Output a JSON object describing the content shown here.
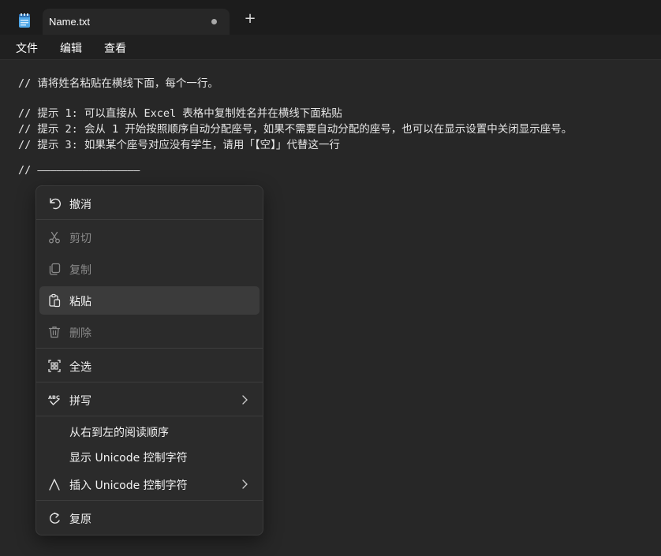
{
  "window": {
    "tab_title": "Name.txt",
    "new_tab_label": "+"
  },
  "menu": {
    "file": "文件",
    "edit": "编辑",
    "view": "查看"
  },
  "editor": {
    "lines": [
      "// 请将姓名粘贴在横线下面，每个一行。",
      "",
      "// 提示 1: 可以直接从 Excel 表格中复制姓名并在横线下面粘贴",
      "// 提示 2: 会从 1 开始按照顺序自动分配座号，如果不需要自动分配的座号，也可以在显示设置中关闭显示座号。",
      "// 提示 3: 如果某个座号对应没有学生，请用「【空】」代替这一行",
      "",
      "// ————————————————"
    ]
  },
  "context_menu": {
    "undo": "撤消",
    "cut": "剪切",
    "copy": "复制",
    "paste": "粘贴",
    "delete": "删除",
    "select_all": "全选",
    "spelling": "拼写",
    "rtl_reading": "从右到左的阅读顺序",
    "show_unicode": "显示 Unicode 控制字符",
    "insert_unicode": "插入 Unicode 控制字符",
    "reconvert": "复原",
    "spell_icon_text": "ABC"
  },
  "icons": {
    "app": "notepad-icon",
    "undo": "undo-icon",
    "cut": "scissors-icon",
    "copy": "copy-icon",
    "paste": "clipboard-icon",
    "delete": "trash-icon",
    "select_all": "select-all-icon",
    "spelling": "spellcheck-icon",
    "insert_unicode": "caret-icon",
    "reconvert": "reconvert-icon",
    "chevron": "chevron-right-icon"
  },
  "colors": {
    "accent_icon": "#5aa7e8",
    "background": "#272727",
    "menu_bg": "#2b2b2b",
    "hover": "#3b3b3b"
  }
}
